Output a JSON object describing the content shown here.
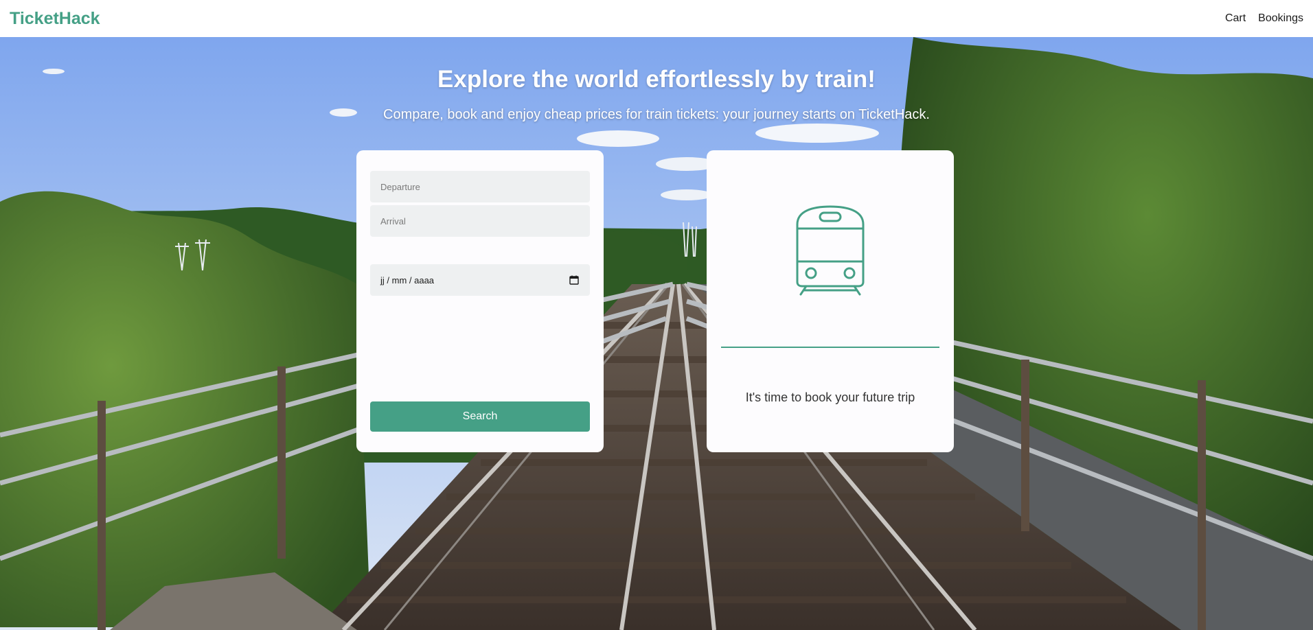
{
  "navbar": {
    "brand": "TicketHack",
    "links": [
      {
        "label": "Cart"
      },
      {
        "label": "Bookings"
      }
    ]
  },
  "hero": {
    "title": "Explore the world effortlessly by train!",
    "subtitle": "Compare, book and enjoy cheap prices for train tickets: your journey starts on TicketHack."
  },
  "search_form": {
    "departure_placeholder": "Departure",
    "arrival_placeholder": "Arrival",
    "date_placeholder": "jj / mm / aaaa",
    "search_label": "Search"
  },
  "info_card": {
    "icon": "train-icon",
    "message": "It's time to book your future trip"
  },
  "colors": {
    "brand_green": "#45a086",
    "field_bg": "#eef0f1",
    "card_bg": "#fdfcfe"
  }
}
